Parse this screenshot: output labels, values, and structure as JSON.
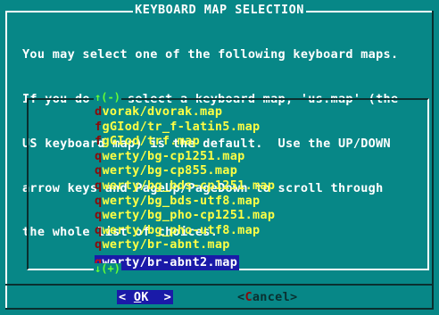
{
  "dialog": {
    "title": "KEYBOARD MAP SELECTION",
    "prompt_lines": [
      "You may select one of the following keyboard maps.",
      "If you do not select a keyboard map, 'us.map' (the",
      "US keyboard map) is the default.  Use the UP/DOWN",
      "arrow keys and PageUp/PageDown to scroll through",
      "the whole list of choices."
    ],
    "scroll_up": "↑(-)",
    "scroll_down": "↓(+)",
    "items": [
      {
        "hot": "d",
        "rest": "vorak/dvorak.map"
      },
      {
        "hot": "f",
        "rest": "gGIod/tr_f-latin5.map"
      },
      {
        "hot": "f",
        "rest": "gGIod/trf.map"
      },
      {
        "hot": "q",
        "rest": "werty/bg-cp1251.map"
      },
      {
        "hot": "q",
        "rest": "werty/bg-cp855.map"
      },
      {
        "hot": "q",
        "rest": "werty/bg_bds-cp1251.map"
      },
      {
        "hot": "q",
        "rest": "werty/bg_bds-utf8.map"
      },
      {
        "hot": "q",
        "rest": "werty/bg_pho-cp1251.map"
      },
      {
        "hot": "q",
        "rest": "werty/bg_pho-utf8.map"
      },
      {
        "hot": "q",
        "rest": "werty/br-abnt.map"
      },
      {
        "hot": "q",
        "rest": "werty/br-abnt2.map"
      }
    ],
    "selected_index": 10,
    "ok_button": {
      "left": "< ",
      "hot": "O",
      "rest": "K",
      "right": "  >"
    },
    "cancel_button": {
      "left": "<",
      "hot": "C",
      "rest": "ancel",
      "right": ">"
    }
  },
  "colors": {
    "background": "#078787",
    "text": "#ffffff",
    "item_text": "#ffff44",
    "hotkey": "#8a0a0a",
    "selection": "#1a1aa8",
    "scroll_indicator": "#66ff33"
  }
}
